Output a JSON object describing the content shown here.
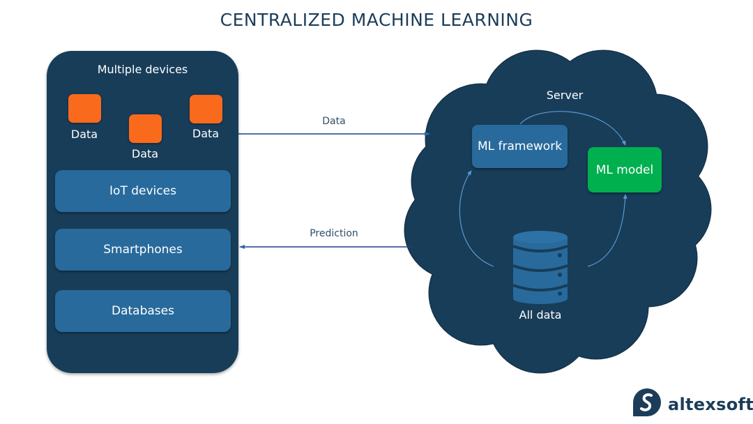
{
  "title": "CENTRALIZED MACHINE LEARNING",
  "devices_panel": {
    "title": "Multiple devices",
    "data_items": [
      "Data",
      "Data",
      "Data"
    ],
    "boxes": [
      "IoT devices",
      "Smartphones",
      "Databases"
    ]
  },
  "arrows": {
    "to_server": "Data",
    "to_devices": "Prediction"
  },
  "server": {
    "title": "Server",
    "ml_framework": "ML framework",
    "ml_model": "ML model",
    "storage": "All data"
  },
  "brand": {
    "name": "altexsoft"
  },
  "colors": {
    "dark_navy": "#183d59",
    "blue_box": "#286a9c",
    "data_orange": "#fa6a1c",
    "model_green": "#00b04f",
    "arrow_blue": "#2d6aa8"
  }
}
